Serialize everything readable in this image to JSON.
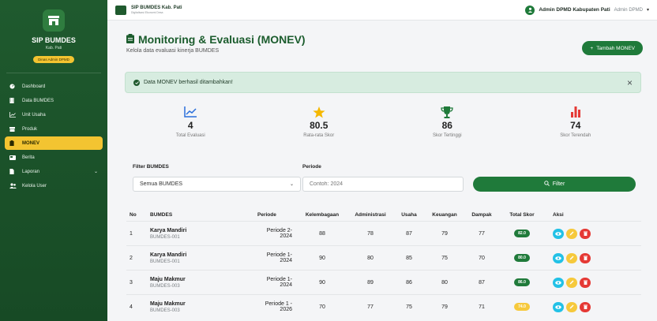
{
  "sidebar": {
    "title": "SIP BUMDES",
    "subtitle": "Kab. Pati",
    "badge": "Dinas Admin DPMD",
    "items": [
      {
        "label": "Dashboard",
        "icon": "gauge-icon"
      },
      {
        "label": "Data BUMDES",
        "icon": "building-icon"
      },
      {
        "label": "Unit Usaha",
        "icon": "chart-line-icon"
      },
      {
        "label": "Produk",
        "icon": "box-icon"
      },
      {
        "label": "MONEV",
        "icon": "clipboard-icon"
      },
      {
        "label": "Berita",
        "icon": "newspaper-icon"
      },
      {
        "label": "Laporan",
        "icon": "file-icon"
      },
      {
        "label": "Kelola User",
        "icon": "users-icon"
      }
    ],
    "active_index": 4
  },
  "topbar": {
    "title": "SIP BUMDES Kab. Pati",
    "subtitle": "Digitalisasi Ekonomi Desa",
    "user_name": "Admin DPMD Kabupaten Pati",
    "user_role": "Admin DPMD"
  },
  "page": {
    "title": "Monitoring & Evaluasi (MONEV)",
    "subtitle": "Kelola data evaluasi kinerja BUMDES",
    "add_button": "Tambah MONEV",
    "alert": "Data MONEV berhasil ditambahkan!"
  },
  "stats": [
    {
      "value": "4",
      "label": "Total Evaluasi",
      "color": "#2a6fdb"
    },
    {
      "value": "80.5",
      "label": "Rata-rata Skor",
      "color": "#f5b800"
    },
    {
      "value": "86",
      "label": "Skor Tertinggi",
      "color": "#1f7a3a"
    },
    {
      "value": "74",
      "label": "Skor Terendah",
      "color": "#e53935"
    }
  ],
  "filter": {
    "bumdes_label": "Filter BUMDES",
    "bumdes_value": "Semua BUMDES",
    "periode_label": "Periode",
    "periode_placeholder": "Contoh: 2024",
    "button": "Filter"
  },
  "table": {
    "headers": [
      "No",
      "BUMDES",
      "Periode",
      "Kelembagaan",
      "Administrasi",
      "Usaha",
      "Keuangan",
      "Dampak",
      "Total Skor",
      "Aksi"
    ],
    "rows": [
      {
        "no": "1",
        "name": "Karya Mandiri",
        "code": "BUMDES-001",
        "periode1": "Periode 2-",
        "periode2": "2024",
        "kel": "88",
        "adm": "78",
        "usa": "87",
        "keu": "79",
        "dam": "77",
        "total": "82.0",
        "total_color": "#1f7a3a"
      },
      {
        "no": "2",
        "name": "Karya Mandiri",
        "code": "BUMDES-001",
        "periode1": "Periode 1-",
        "periode2": "2024",
        "kel": "90",
        "adm": "80",
        "usa": "85",
        "keu": "75",
        "dam": "70",
        "total": "80.0",
        "total_color": "#1f7a3a"
      },
      {
        "no": "3",
        "name": "Maju Makmur",
        "code": "BUMDES-003",
        "periode1": "Periode 1-",
        "periode2": "2024",
        "kel": "90",
        "adm": "89",
        "usa": "86",
        "keu": "80",
        "dam": "87",
        "total": "86.0",
        "total_color": "#1f7a3a"
      },
      {
        "no": "4",
        "name": "Maju Makmur",
        "code": "BUMDES-003",
        "periode1": "Periode 1 -",
        "periode2": "2026",
        "kel": "70",
        "adm": "77",
        "usa": "75",
        "keu": "79",
        "dam": "71",
        "total": "74.0",
        "total_color": "#f6c93c"
      }
    ]
  }
}
